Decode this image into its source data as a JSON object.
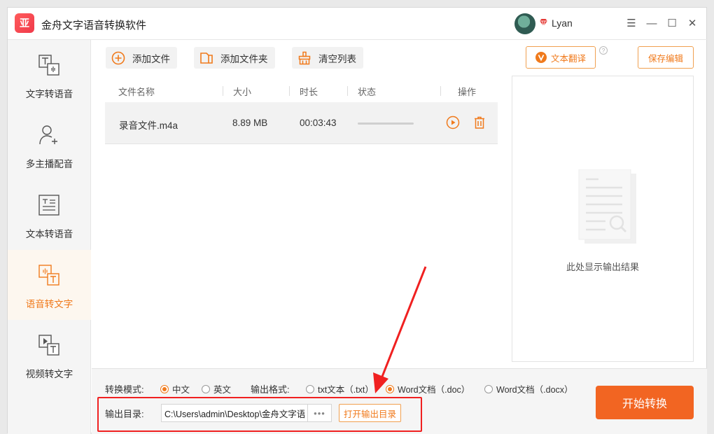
{
  "app": {
    "logo_glyph": "亚",
    "title": "金舟文字语音转换软件"
  },
  "user": {
    "name": "Lyan",
    "vip_icon": "gem-icon"
  },
  "window_controls": {
    "menu": "☰",
    "minimize": "—",
    "maximize": "☐",
    "close": "✕"
  },
  "sidebar": {
    "items": [
      {
        "label": "文字转语音",
        "icon": "text-to-speech-icon",
        "active": false
      },
      {
        "label": "多主播配音",
        "icon": "user-add-icon",
        "active": false
      },
      {
        "label": "文本转语音",
        "icon": "document-icon",
        "active": false
      },
      {
        "label": "语音转文字",
        "icon": "speech-to-text-icon",
        "active": true
      },
      {
        "label": "视频转文字",
        "icon": "video-to-text-icon",
        "active": false
      }
    ]
  },
  "toolbar": {
    "add_file": "添加文件",
    "add_folder": "添加文件夹",
    "clear_list": "清空列表",
    "translate": "文本翻译",
    "save_edit": "保存编辑",
    "help": "?"
  },
  "table": {
    "headers": [
      "文件名称",
      "大小",
      "时长",
      "状态",
      "操作"
    ],
    "rows": [
      {
        "name": "录音文件.m4a",
        "size": "8.89 MB",
        "duration": "00:03:43",
        "progress": 0
      }
    ]
  },
  "result_panel": {
    "placeholder": "此处显示输出结果"
  },
  "bottom": {
    "mode_label": "转换模式:",
    "mode_options": [
      {
        "label": "中文",
        "checked": true
      },
      {
        "label": "英文",
        "checked": false
      }
    ],
    "format_label": "输出格式:",
    "format_options": [
      {
        "label": "txt文本（.txt）",
        "checked": false
      },
      {
        "label": "Word文档（.doc）",
        "checked": true
      },
      {
        "label": "Word文档（.docx）",
        "checked": false
      }
    ],
    "output_label": "输出目录:",
    "output_path": "C:\\Users\\admin\\Desktop\\金舟文字语音转换软件",
    "browse": "•••",
    "open_dir": "打开输出目录",
    "start": "开始转换"
  },
  "colors": {
    "accent": "#f07a1c",
    "start_button": "#f26522",
    "annotation": "#f02020"
  }
}
